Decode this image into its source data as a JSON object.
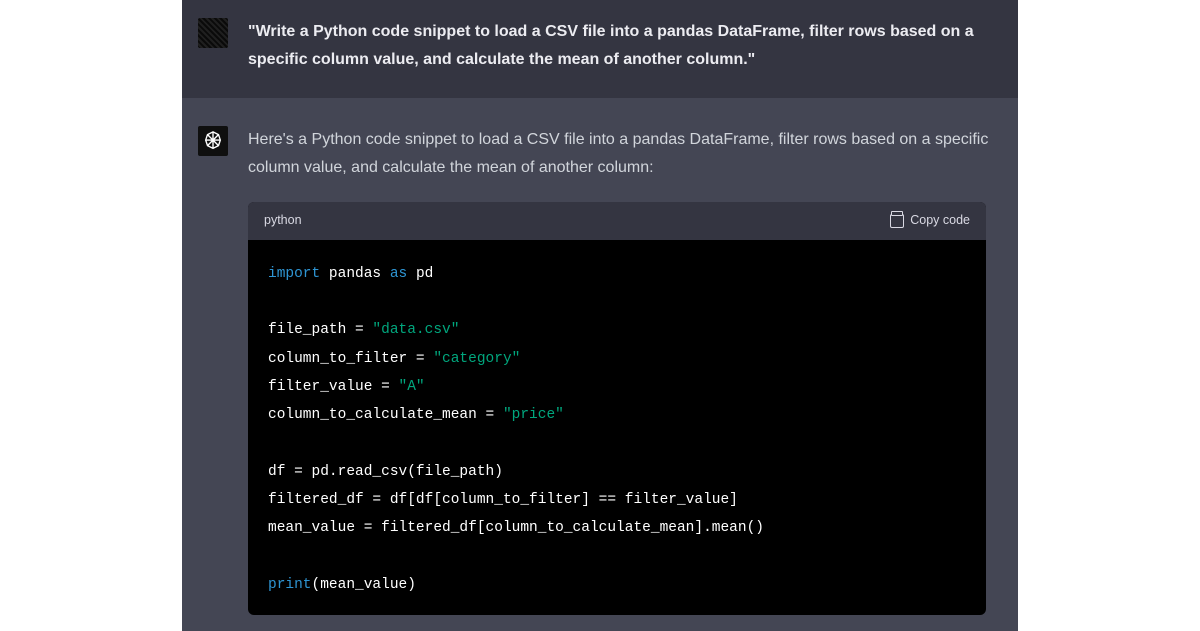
{
  "user_message": "\"Write a Python code snippet to load a CSV file into a pandas DataFrame, filter rows based on a specific column value, and calculate the mean of another column.\"",
  "assistant_message": "Here's a Python code snippet to load a CSV file into a pandas DataFrame, filter rows based on a specific column value, and calculate the mean of another column:",
  "code": {
    "language": "python",
    "copy_label": "Copy code",
    "tokens": [
      [
        {
          "t": "import",
          "c": "keyword"
        },
        {
          "t": " pandas ",
          "c": "default"
        },
        {
          "t": "as",
          "c": "keyword"
        },
        {
          "t": " pd",
          "c": "default"
        }
      ],
      [],
      [
        {
          "t": "file_path = ",
          "c": "default"
        },
        {
          "t": "\"data.csv\"",
          "c": "string"
        }
      ],
      [
        {
          "t": "column_to_filter = ",
          "c": "default"
        },
        {
          "t": "\"category\"",
          "c": "string"
        }
      ],
      [
        {
          "t": "filter_value = ",
          "c": "default"
        },
        {
          "t": "\"A\"",
          "c": "string"
        }
      ],
      [
        {
          "t": "column_to_calculate_mean = ",
          "c": "default"
        },
        {
          "t": "\"price\"",
          "c": "string"
        }
      ],
      [],
      [
        {
          "t": "df = pd.read_csv(file_path)",
          "c": "default"
        }
      ],
      [
        {
          "t": "filtered_df = df[df[column_to_filter] == filter_value]",
          "c": "default"
        }
      ],
      [
        {
          "t": "mean_value = filtered_df[column_to_calculate_mean].mean()",
          "c": "default"
        }
      ],
      [],
      [
        {
          "t": "print",
          "c": "builtin2"
        },
        {
          "t": "(mean_value)",
          "c": "default"
        }
      ]
    ]
  }
}
